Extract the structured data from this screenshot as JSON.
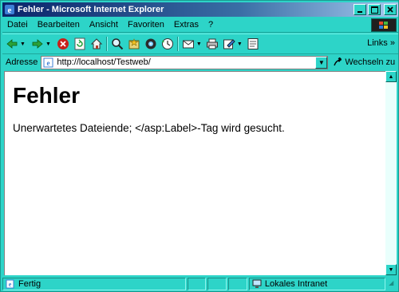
{
  "window": {
    "title": "Fehler - Microsoft Internet Explorer",
    "icon": "ie-icon",
    "buttons": [
      "minimize",
      "maximize",
      "close"
    ]
  },
  "menubar": {
    "items": [
      {
        "label": "Datei"
      },
      {
        "label": "Bearbeiten"
      },
      {
        "label": "Ansicht"
      },
      {
        "label": "Favoriten"
      },
      {
        "label": "Extras"
      },
      {
        "label": "?"
      }
    ]
  },
  "toolbar": {
    "buttons": [
      {
        "icon": "back-icon"
      },
      {
        "icon": "forward-icon"
      },
      {
        "icon": "stop-icon"
      },
      {
        "icon": "refresh-icon"
      },
      {
        "icon": "home-icon"
      },
      {
        "icon": "search-icon"
      },
      {
        "icon": "favorites-icon"
      },
      {
        "icon": "media-icon"
      },
      {
        "icon": "history-icon"
      },
      {
        "icon": "mail-icon"
      },
      {
        "icon": "print-icon"
      },
      {
        "icon": "edit-icon"
      },
      {
        "icon": "discuss-icon"
      }
    ],
    "links_label": "Links",
    "links_chevron": "»"
  },
  "addressbar": {
    "label": "Adresse",
    "value": "http://localhost/Testweb/",
    "go_label": "Wechseln zu"
  },
  "page": {
    "heading": "Fehler",
    "message": "Unerwartetes Dateiende; </asp:Label>-Tag wird gesucht."
  },
  "statusbar": {
    "status": "Fertig",
    "zone": "Lokales Intranet"
  },
  "colors": {
    "chrome": "#2dd4c8",
    "title_start": "#0a246a",
    "title_end": "#a6caf0"
  }
}
